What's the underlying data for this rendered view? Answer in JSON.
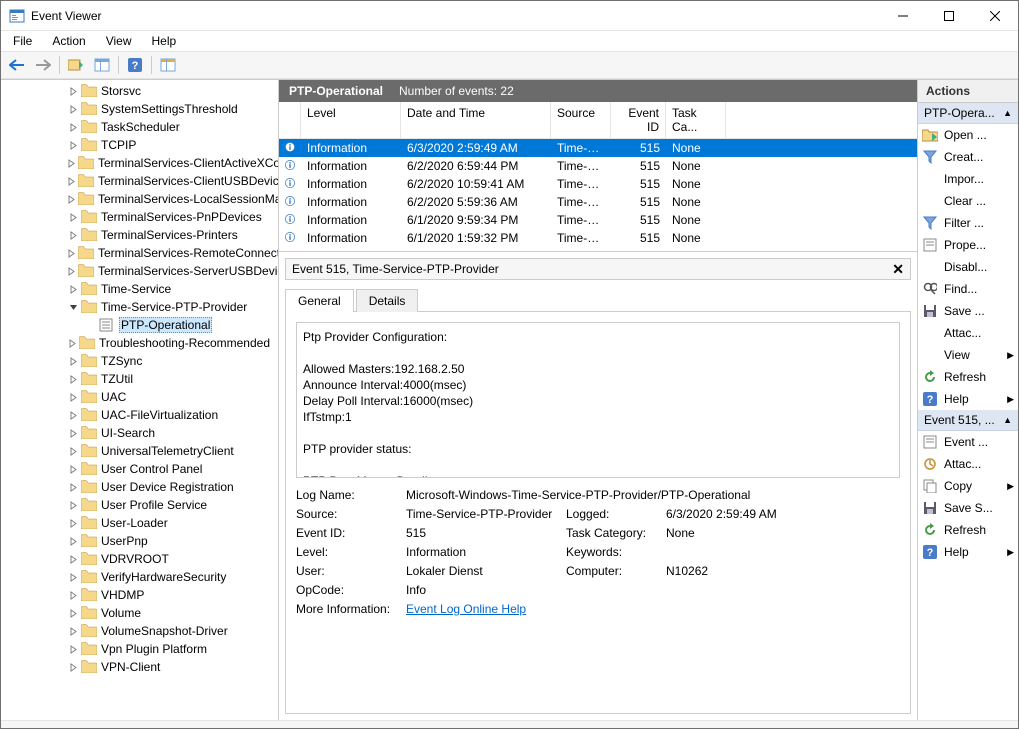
{
  "window": {
    "title": "Event Viewer"
  },
  "menu": {
    "file": "File",
    "action": "Action",
    "view": "View",
    "help": "Help"
  },
  "tree": {
    "items": [
      {
        "label": "Storsvc",
        "expand": ">",
        "indent": 66
      },
      {
        "label": "SystemSettingsThreshold",
        "expand": ">",
        "indent": 66
      },
      {
        "label": "TaskScheduler",
        "expand": ">",
        "indent": 66
      },
      {
        "label": "TCPIP",
        "expand": ">",
        "indent": 66
      },
      {
        "label": "TerminalServices-ClientActiveXCore",
        "expand": ">",
        "indent": 66
      },
      {
        "label": "TerminalServices-ClientUSBDevices",
        "expand": ">",
        "indent": 66
      },
      {
        "label": "TerminalServices-LocalSessionManager",
        "expand": ">",
        "indent": 66
      },
      {
        "label": "TerminalServices-PnPDevices",
        "expand": ">",
        "indent": 66
      },
      {
        "label": "TerminalServices-Printers",
        "expand": ">",
        "indent": 66
      },
      {
        "label": "TerminalServices-RemoteConnectionManager",
        "expand": ">",
        "indent": 66
      },
      {
        "label": "TerminalServices-ServerUSBDevices",
        "expand": ">",
        "indent": 66
      },
      {
        "label": "Time-Service",
        "expand": ">",
        "indent": 66
      },
      {
        "label": "Time-Service-PTP-Provider",
        "expand": "v",
        "indent": 66
      },
      {
        "label": "PTP-Operational",
        "expand": "",
        "indent": 84,
        "selected": true,
        "log": true
      },
      {
        "label": "Troubleshooting-Recommended",
        "expand": ">",
        "indent": 66
      },
      {
        "label": "TZSync",
        "expand": ">",
        "indent": 66
      },
      {
        "label": "TZUtil",
        "expand": ">",
        "indent": 66
      },
      {
        "label": "UAC",
        "expand": ">",
        "indent": 66
      },
      {
        "label": "UAC-FileVirtualization",
        "expand": ">",
        "indent": 66
      },
      {
        "label": "UI-Search",
        "expand": ">",
        "indent": 66
      },
      {
        "label": "UniversalTelemetryClient",
        "expand": ">",
        "indent": 66
      },
      {
        "label": "User Control Panel",
        "expand": ">",
        "indent": 66
      },
      {
        "label": "User Device Registration",
        "expand": ">",
        "indent": 66
      },
      {
        "label": "User Profile Service",
        "expand": ">",
        "indent": 66
      },
      {
        "label": "User-Loader",
        "expand": ">",
        "indent": 66
      },
      {
        "label": "UserPnp",
        "expand": ">",
        "indent": 66
      },
      {
        "label": "VDRVROOT",
        "expand": ">",
        "indent": 66
      },
      {
        "label": "VerifyHardwareSecurity",
        "expand": ">",
        "indent": 66
      },
      {
        "label": "VHDMP",
        "expand": ">",
        "indent": 66
      },
      {
        "label": "Volume",
        "expand": ">",
        "indent": 66
      },
      {
        "label": "VolumeSnapshot-Driver",
        "expand": ">",
        "indent": 66
      },
      {
        "label": "Vpn Plugin Platform",
        "expand": ">",
        "indent": 66
      },
      {
        "label": "VPN-Client",
        "expand": ">",
        "indent": 66
      }
    ]
  },
  "main": {
    "header_name": "PTP-Operational",
    "header_count": "Number of events: 22",
    "columns": {
      "level": "Level",
      "date": "Date and Time",
      "source": "Source",
      "eventid": "Event ID",
      "task": "Task Ca..."
    },
    "rows": [
      {
        "level": "Information",
        "date": "6/3/2020 2:59:49 AM",
        "source": "Time-S...",
        "eventid": "515",
        "task": "None",
        "selected": true
      },
      {
        "level": "Information",
        "date": "6/2/2020 6:59:44 PM",
        "source": "Time-S...",
        "eventid": "515",
        "task": "None"
      },
      {
        "level": "Information",
        "date": "6/2/2020 10:59:41 AM",
        "source": "Time-S...",
        "eventid": "515",
        "task": "None"
      },
      {
        "level": "Information",
        "date": "6/2/2020 5:59:36 AM",
        "source": "Time-S...",
        "eventid": "515",
        "task": "None"
      },
      {
        "level": "Information",
        "date": "6/1/2020 9:59:34 PM",
        "source": "Time-S...",
        "eventid": "515",
        "task": "None"
      },
      {
        "level": "Information",
        "date": "6/1/2020 1:59:32 PM",
        "source": "Time-S...",
        "eventid": "515",
        "task": "None"
      }
    ]
  },
  "detail": {
    "title": "Event 515, Time-Service-PTP-Provider",
    "tab_general": "General",
    "tab_details": "Details",
    "body_text": "Ptp Provider Configuration:\n\nAllowed Masters:192.168.2.50\nAnnounce Interval:4000(msec)\nDelay Poll Interval:16000(msec)\nIfTstmp:1\n\nPTP provider status:\n\nPTP Best Master Details:\nName:",
    "grid": {
      "logname_l": "Log Name:",
      "logname_v": "Microsoft-Windows-Time-Service-PTP-Provider/PTP-Operational",
      "source_l": "Source:",
      "source_v": "Time-Service-PTP-Provider",
      "logged_l": "Logged:",
      "logged_v": "6/3/2020 2:59:49 AM",
      "eventid_l": "Event ID:",
      "eventid_v": "515",
      "taskcat_l": "Task Category:",
      "taskcat_v": "None",
      "level_l": "Level:",
      "level_v": "Information",
      "keywords_l": "Keywords:",
      "keywords_v": "",
      "user_l": "User:",
      "user_v": "Lokaler Dienst",
      "computer_l": "Computer:",
      "computer_v": "N10262",
      "opcode_l": "OpCode:",
      "opcode_v": "Info",
      "moreinfo_l": "More Information:",
      "moreinfo_link": "Event Log Online Help"
    }
  },
  "actions": {
    "title": "Actions",
    "section1": "PTP-Opera...",
    "items1": [
      {
        "label": "Open ...",
        "icon": "folder"
      },
      {
        "label": "Creat...",
        "icon": "funnel"
      },
      {
        "label": "Impor...",
        "icon": ""
      },
      {
        "label": "Clear ...",
        "icon": ""
      },
      {
        "label": "Filter ...",
        "icon": "funnel"
      },
      {
        "label": "Prope...",
        "icon": "props"
      },
      {
        "label": "Disabl...",
        "icon": ""
      },
      {
        "label": "Find...",
        "icon": "find"
      },
      {
        "label": "Save ...",
        "icon": "save"
      },
      {
        "label": "Attac...",
        "icon": ""
      },
      {
        "label": "View",
        "icon": "",
        "arrow": true
      },
      {
        "label": "Refresh",
        "icon": "refresh"
      },
      {
        "label": "Help",
        "icon": "help",
        "arrow": true
      }
    ],
    "section2": "Event 515, ...",
    "items2": [
      {
        "label": "Event ...",
        "icon": "props"
      },
      {
        "label": "Attac...",
        "icon": "attach"
      },
      {
        "label": "Copy",
        "icon": "copy",
        "arrow": true
      },
      {
        "label": "Save S...",
        "icon": "save"
      },
      {
        "label": "Refresh",
        "icon": "refresh"
      },
      {
        "label": "Help",
        "icon": "help",
        "arrow": true
      }
    ]
  }
}
